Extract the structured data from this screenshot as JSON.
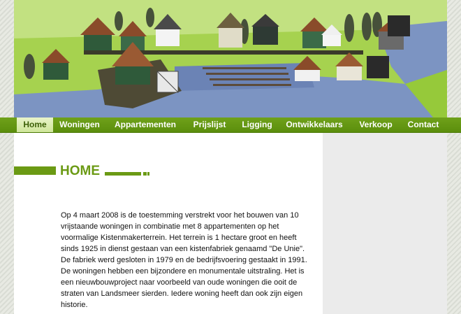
{
  "nav": {
    "items": [
      {
        "label": "Home",
        "active": true
      },
      {
        "label": "Woningen",
        "active": false
      },
      {
        "label": "Appartementen",
        "active": false
      },
      {
        "label": "Prijslijst",
        "active": false
      },
      {
        "label": "Ligging",
        "active": false
      },
      {
        "label": "Ontwikkelaars",
        "active": false
      },
      {
        "label": "Verkoop",
        "active": false
      },
      {
        "label": "Contact",
        "active": false
      }
    ]
  },
  "page": {
    "title": "HOME",
    "body": "Op 4 maart 2008 is de toestemming verstrekt voor het bouwen van 10 vrijstaande woningen in combinatie met 8 appartementen op het voormalige Kistenmakerterrein. Het terrein is 1 hectare groot en heeft sinds 1925 in dienst gestaan van een kistenfabriek genaamd \"De Unie\". De fabriek werd gesloten in 1979 en de bedrijfsvoering gestaakt in 1991. De woningen hebben een bijzondere en monumentale uitstraling. Het is een nieuwbouwproject naar voorbeeld van oude woningen die ooit de straten van Landsmeer sierden. Iedere woning heeft dan ook zijn eigen historie."
  },
  "colors": {
    "accent_green": "#6b9a14",
    "nav_green": "#5b8e0c",
    "active_tab": "#cfe69a",
    "sidebar_gray": "#ebebeb"
  },
  "hero": {
    "image": "village-illustration"
  }
}
